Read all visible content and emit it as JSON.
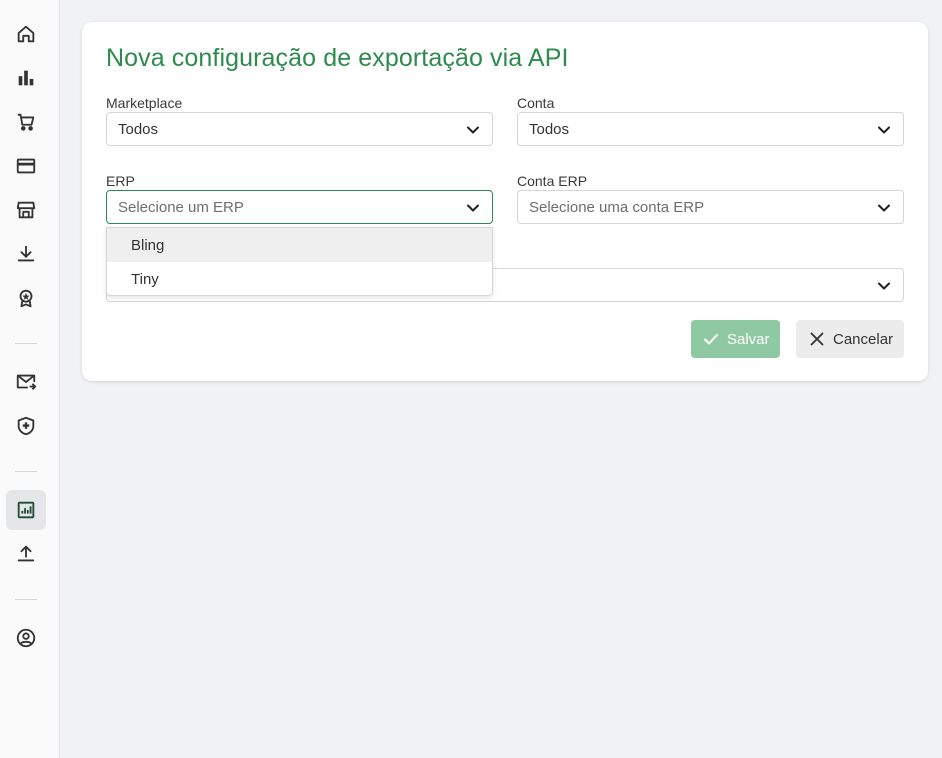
{
  "sidebar": {
    "items": [
      {
        "icon": "home-icon"
      },
      {
        "icon": "bar-chart-icon"
      },
      {
        "icon": "shopping-cart-icon"
      },
      {
        "icon": "credit-card-icon"
      },
      {
        "icon": "store-icon"
      },
      {
        "icon": "download-icon"
      },
      {
        "icon": "award-icon"
      },
      {
        "icon": "mail-forward-icon"
      },
      {
        "icon": "shield-plus-icon"
      },
      {
        "icon": "report-icon",
        "active": true
      },
      {
        "icon": "upload-icon"
      },
      {
        "icon": "user-circle-icon"
      }
    ]
  },
  "form": {
    "title": "Nova configuração de exportação via API",
    "marketplace": {
      "label": "Marketplace",
      "value": "Todos"
    },
    "conta": {
      "label": "Conta",
      "value": "Todos"
    },
    "erp": {
      "label": "ERP",
      "placeholder": "Selecione um ERP",
      "options": [
        "Bling",
        "Tiny"
      ]
    },
    "conta_erp": {
      "label": "Conta ERP",
      "placeholder": "Selecione uma conta ERP"
    },
    "save_label": "Salvar",
    "cancel_label": "Cancelar"
  },
  "colors": {
    "accent": "#2e8b4e",
    "save_button_disabled": "#8fc9a3",
    "background": "#f1f2f4"
  }
}
